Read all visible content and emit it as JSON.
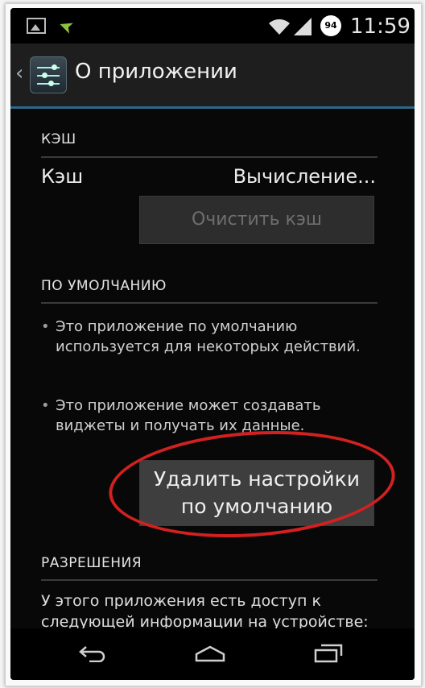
{
  "status_bar": {
    "battery_level": "94",
    "time": "11:59"
  },
  "action_bar": {
    "title": "О приложении"
  },
  "cache": {
    "header": "КЭШ",
    "label": "Кэш",
    "value": "Вычисление...",
    "clear_button": "Очистить кэш"
  },
  "defaults": {
    "header": "ПО УМОЛЧАНИЮ",
    "bullets": [
      "Это приложение по умолчанию используется для некоторых действий.",
      "Это приложение может создавать виджеты и получать их данные."
    ],
    "clear_defaults_button_line1": "Удалить настройки",
    "clear_defaults_button_line2": "по умолчанию"
  },
  "permissions": {
    "header": "РАЗРЕШЕНИЯ",
    "text": "У этого приложения есть доступ к следующей информации на устройстве:"
  },
  "colors": {
    "highlight_circle": "#d32020",
    "action_bar_divider": "#2a6a8a",
    "notification_accent": "#8ec23f"
  },
  "icons": {
    "notification_1": "image-icon",
    "notification_2": "airplane-icon",
    "nav_back": "back-icon",
    "nav_home": "home-icon",
    "nav_recent": "recent-apps-icon"
  }
}
